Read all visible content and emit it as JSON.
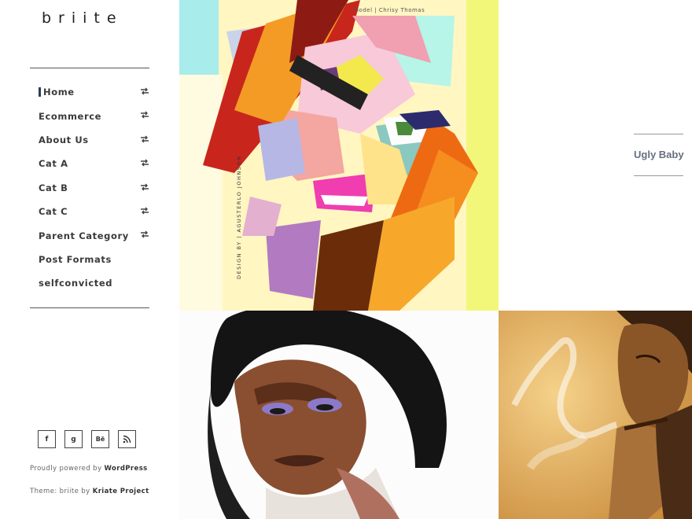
{
  "site": {
    "logo": "briite"
  },
  "menu": {
    "items": [
      {
        "label": "Home",
        "has_submenu": true,
        "active": true
      },
      {
        "label": "Ecommerce",
        "has_submenu": true
      },
      {
        "label": "About Us",
        "has_submenu": true
      },
      {
        "label": "Cat A",
        "has_submenu": true
      },
      {
        "label": "Cat B",
        "has_submenu": true
      },
      {
        "label": "Cat C",
        "has_submenu": true
      },
      {
        "label": "Parent Category",
        "has_submenu": true
      },
      {
        "label": "Post Formats",
        "has_submenu": false
      },
      {
        "label": "selfconvicted",
        "has_submenu": false
      }
    ],
    "submenu_icon": "swap-arrows-icon"
  },
  "social": [
    {
      "name": "facebook-icon",
      "glyph": "f"
    },
    {
      "name": "google-plus-icon",
      "glyph": "g"
    },
    {
      "name": "behance-icon",
      "glyph": "Bē"
    },
    {
      "name": "rss-icon",
      "glyph": "rss"
    }
  ],
  "footer": {
    "powered_prefix": "Proudly powered by ",
    "powered_link": "WordPress",
    "theme_prefix": "Theme: briite by ",
    "theme_link": "Kriate Project"
  },
  "posts": {
    "featured_title": "Ugly Baby",
    "art1_caption_top": "Model | Chrisy Thomas",
    "art1_caption_side": "DESIGN BY | AGUSTERLO JOHNSON"
  },
  "colors": {
    "accent": "#2f3b59",
    "post_title": "#666f80"
  }
}
